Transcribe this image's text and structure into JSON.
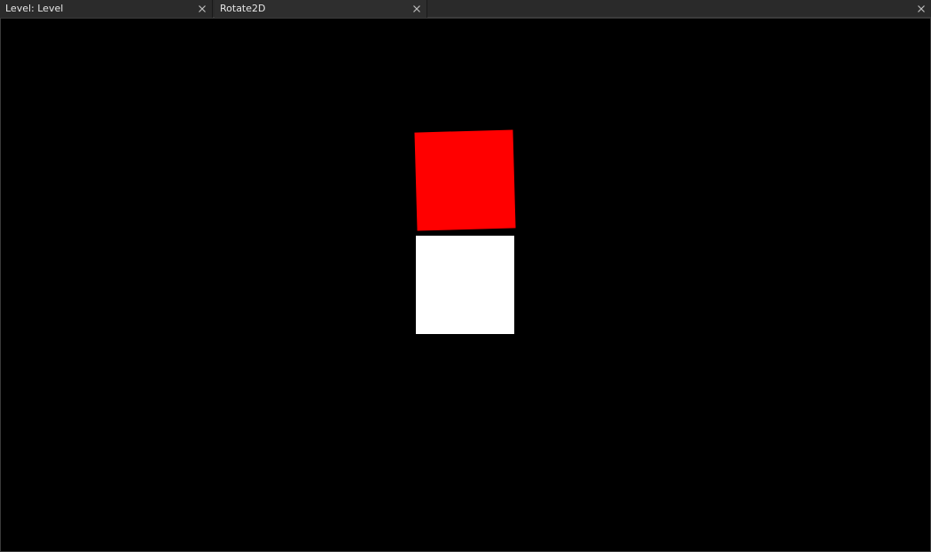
{
  "tabs": [
    {
      "label": "Level: Level",
      "close_icon": "close-icon"
    },
    {
      "label": "Rotate2D",
      "close_icon": "close-icon"
    }
  ],
  "panel": {
    "close_icon": "close-icon"
  },
  "viewport": {
    "background": "#000000",
    "sprites": [
      {
        "name": "red-square",
        "color": "#ff0000",
        "rotation_deg": -1.6
      },
      {
        "name": "white-square",
        "color": "#ffffff",
        "rotation_deg": 0
      }
    ]
  }
}
